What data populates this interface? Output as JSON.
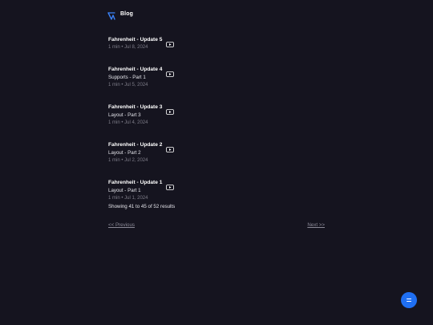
{
  "header": {
    "brand": "Blog",
    "accent_color": "#3b82f6"
  },
  "posts": [
    {
      "title": "Fahrenheit - Update 5",
      "subtitle": "",
      "meta": "1 min • Jul 8, 2024",
      "icon": "video-icon"
    },
    {
      "title": "Fahrenheit - Update 4",
      "subtitle": "Supports - Part 1",
      "meta": "1 min • Jul 5, 2024",
      "icon": "video-icon"
    },
    {
      "title": "Fahrenheit - Update 3",
      "subtitle": "Layout - Part 3",
      "meta": "1 min • Jul 4, 2024",
      "icon": "video-icon"
    },
    {
      "title": "Fahrenheit - Update 2",
      "subtitle": "Layout - Part 2",
      "meta": "1 min • Jul 2, 2024",
      "icon": "video-icon"
    },
    {
      "title": "Fahrenheit - Update 1",
      "subtitle": "Layout - Part 1",
      "meta": "1 min • Jul 1, 2024",
      "icon": "video-icon"
    }
  ],
  "results": {
    "text": "Showing 41 to 45 of 52 results"
  },
  "pagination": {
    "previous_label": "<< Previous",
    "next_label": "Next >>"
  },
  "fab": {
    "icon": "menu-icon",
    "color": "#1f6ff2"
  }
}
